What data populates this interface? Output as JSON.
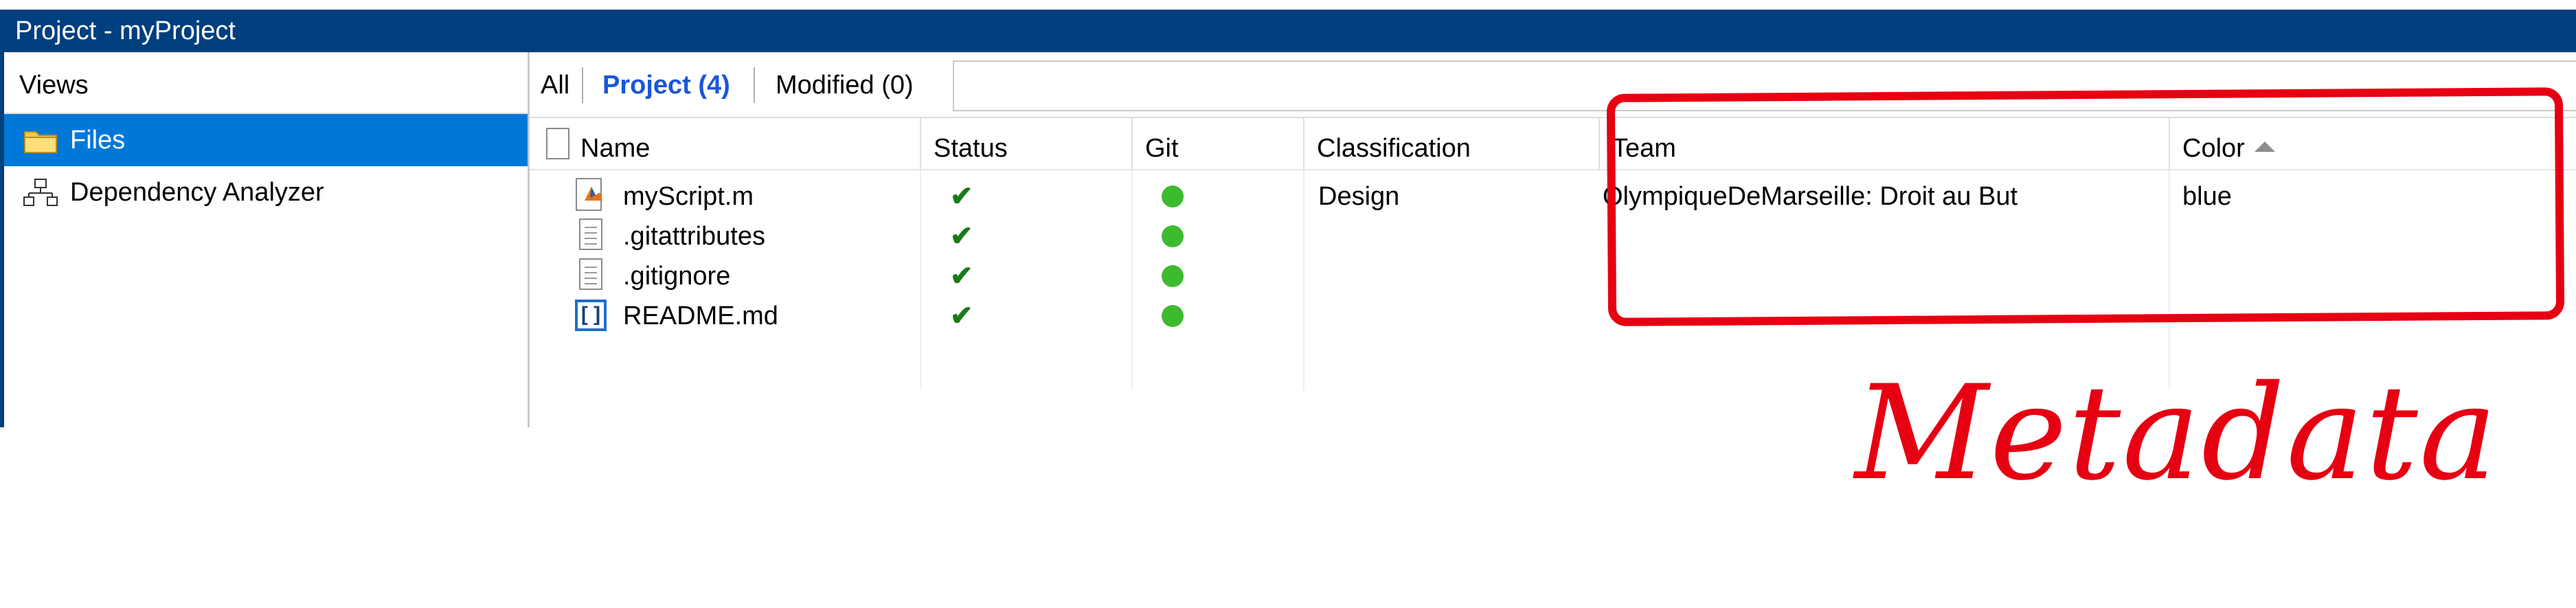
{
  "window": {
    "title": "Project - myProject"
  },
  "views": {
    "header": "Views",
    "items": [
      {
        "label": "Files",
        "icon": "folder-icon",
        "selected": true
      },
      {
        "label": "Dependency Analyzer",
        "icon": "hierarchy-icon",
        "selected": false
      }
    ]
  },
  "tabs": [
    {
      "label": "All",
      "active": false
    },
    {
      "label": "Project (4)",
      "active": true
    },
    {
      "label": "Modified (0)",
      "active": false
    }
  ],
  "search": {
    "value": "",
    "placeholder": ""
  },
  "columns": {
    "name": "Name",
    "status": "Status",
    "git": "Git",
    "classification": "Classification",
    "team": "Team",
    "color": "Color"
  },
  "files": [
    {
      "name": "myScript.m",
      "icon": "matlab-file-icon",
      "status": "✔",
      "git": "up-to-date",
      "classification": "Design",
      "team": "OlympiqueDeMarseille: Droit au But",
      "color": "blue"
    },
    {
      "name": ".gitattributes",
      "icon": "text-file-icon",
      "status": "✔",
      "git": "up-to-date",
      "classification": "",
      "team": "",
      "color": ""
    },
    {
      "name": ".gitignore",
      "icon": "text-file-icon",
      "status": "✔",
      "git": "up-to-date",
      "classification": "",
      "team": "",
      "color": ""
    },
    {
      "name": "README.md",
      "icon": "markdown-file-icon",
      "status": "✔",
      "git": "up-to-date",
      "classification": "",
      "team": "",
      "color": ""
    }
  ],
  "annotation": {
    "label": "Metadata",
    "color": "#e60012"
  },
  "colors": {
    "titlebar": "#003f7d",
    "selected": "#0078d7",
    "active_tab": "#1a56db",
    "git_ok": "#3dbb2f",
    "check": "#1a7a1a"
  }
}
